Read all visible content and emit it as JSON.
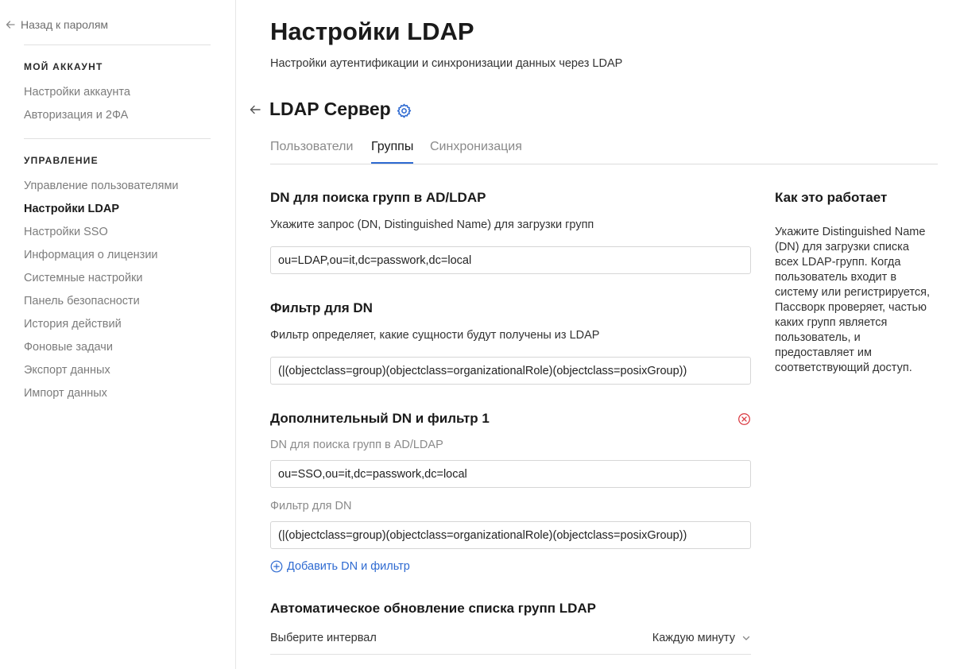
{
  "sidebar": {
    "back_label": "Назад к паролям",
    "sections": [
      {
        "heading": "МОЙ АККАУНТ",
        "items": [
          "Настройки аккаунта",
          "Авторизация и 2ФА"
        ]
      },
      {
        "heading": "УПРАВЛЕНИЕ",
        "items": [
          "Управление пользователями",
          "Настройки LDAP",
          "Настройки SSO",
          "Информация о лицензии",
          "Системные настройки",
          "Панель безопасности",
          "История действий",
          "Фоновые задачи",
          "Экспорт данных",
          "Импорт данных"
        ]
      }
    ],
    "active_item": "Настройки LDAP"
  },
  "header": {
    "title": "Настройки LDAP",
    "subtitle": "Настройки аутентификации и синхронизации данных через LDAP"
  },
  "server": {
    "title": "LDAP Сервер",
    "tabs": [
      "Пользователи",
      "Группы",
      "Синхронизация"
    ],
    "active_tab": "Группы"
  },
  "groups_form": {
    "dn_search": {
      "title": "DN для поиска групп в AD/LDAP",
      "description": "Укажите запрос (DN, Distinguished Name) для загрузки групп",
      "value": "ou=LDAP,ou=it,dc=passwork,dc=local"
    },
    "dn_filter": {
      "title": "Фильтр для DN",
      "description": "Фильтр определяет, какие сущности будут получены из LDAP",
      "value": "(|(objectclass=group)(objectclass=organizationalRole)(objectclass=posixGroup))"
    },
    "extra": {
      "title": "Дополнительный DN и фильтр 1",
      "dn_label": "DN для поиска групп в AD/LDAP",
      "dn_value": "ou=SSO,ou=it,dc=passwork,dc=local",
      "filter_label": "Фильтр для DN",
      "filter_value": "(|(objectclass=group)(objectclass=organizationalRole)(objectclass=posixGroup))"
    },
    "add_label": "Добавить DN и фильтр",
    "auto_update": {
      "title": "Автоматическое обновление списка групп LDAP",
      "interval_label": "Выберите интервал",
      "interval_value": "Каждую минуту"
    }
  },
  "help": {
    "title": "Как это работает",
    "text": "Укажите Distinguished Name (DN) для загрузки списка всех LDAP-групп. Когда пользователь входит в систему или регистрируется, Пассворк проверяет, частью каких групп является пользователь, и предоставляет им соответствующий доступ."
  },
  "colors": {
    "accent": "#2e6ad1",
    "danger": "#d9363e",
    "muted_text": "#7c7c7c"
  },
  "icons": [
    "arrow-left-icon",
    "gear-icon",
    "remove-circle-icon",
    "plus-circle-icon",
    "chevron-down-icon"
  ]
}
